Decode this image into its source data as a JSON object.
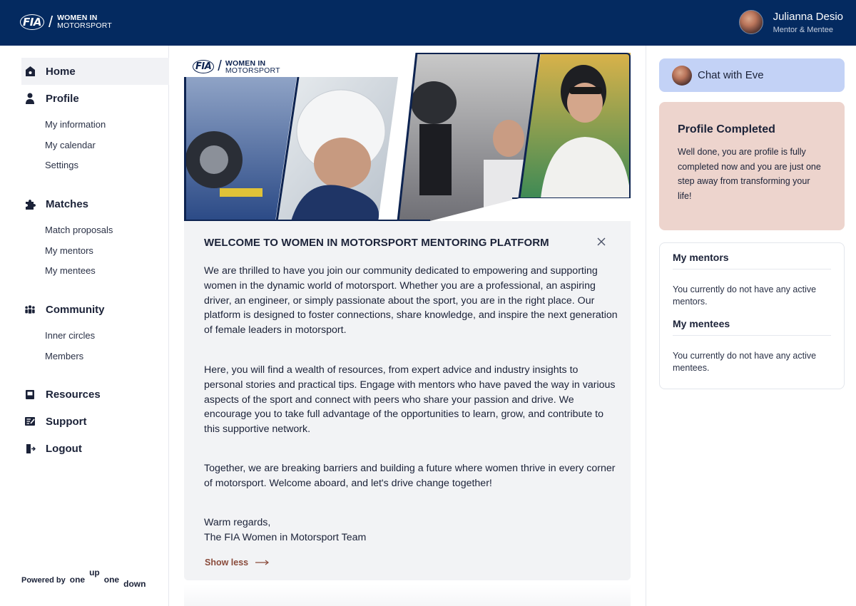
{
  "header": {
    "logo_mark": "FIA",
    "logo_line1": "WOMEN IN",
    "logo_line2": "MOTORSPORT",
    "user_name": "Julianna Desio",
    "user_role": "Mentor & Mentee",
    "bg_color": "#042a60"
  },
  "sidebar": {
    "home": {
      "label": "Home",
      "icon": "home-icon"
    },
    "profile": {
      "label": "Profile",
      "icon": "user-icon",
      "items": [
        "My information",
        "My calendar",
        "Settings"
      ]
    },
    "matches": {
      "label": "Matches",
      "icon": "puzzle-icon",
      "items": [
        "Match proposals",
        "My mentors",
        "My mentees"
      ]
    },
    "community": {
      "label": "Community",
      "icon": "group-icon",
      "items": [
        "Inner circles",
        "Members"
      ]
    },
    "resources": {
      "label": "Resources",
      "icon": "book-icon"
    },
    "support": {
      "label": "Support",
      "icon": "support-icon"
    },
    "logout": {
      "label": "Logout",
      "icon": "logout-icon"
    },
    "powered_by": "Powered by",
    "brand": [
      "one",
      "up",
      "one",
      "down"
    ]
  },
  "welcome": {
    "title": "WELCOME TO WOMEN IN MOTORSPORT MENTORING PLATFORM",
    "paragraphs": [
      "We are thrilled to have you join our community dedicated to empowering and supporting women in the dynamic world of motorsport. Whether you are a professional, an aspiring driver, an engineer, or simply passionate about the sport, you are in the right place. Our platform is designed to foster connections, share knowledge, and inspire the next generation of female leaders in motorsport.",
      "Here, you will find a wealth of resources, from expert advice and industry insights to personal stories and practical tips. Engage with mentors who have paved the way in various aspects of the sport and connect with peers who share your passion and drive. We encourage you to take full advantage of the opportunities to learn, grow, and contribute to this supportive network.",
      "Together, we are breaking barriers and building a future where women thrive in every corner of motorsport. Welcome aboard, and let's drive change together!"
    ],
    "signoff_1": "Warm regards,",
    "signoff_2": "The FIA Women in Motorsport Team",
    "show_less": "Show less"
  },
  "right": {
    "chat_label": "Chat with Eve",
    "profile_title": "Profile Completed",
    "profile_text": "Well done, you are profile is fully completed now and you are just one step away from transforming your life!",
    "mentors_title": "My mentors",
    "mentors_text": "You currently do not have any active mentors.",
    "mentees_title": "My mentees",
    "mentees_text": "You currently do not have any active mentees."
  },
  "colors": {
    "chat_bg": "#c3d2f6",
    "profile_bg": "#edd4cd",
    "accent_link": "#8a4b3b"
  }
}
